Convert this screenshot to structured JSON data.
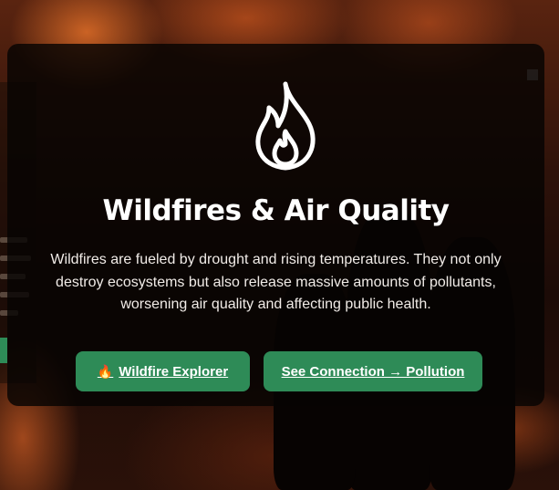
{
  "hero": {
    "title": "Wildfires & Air Quality",
    "description": "Wildfires are fueled by drought and rising temperatures. They not only destroy ecosystems but also release massive amounts of pollutants, worsening air quality and affecting public health."
  },
  "buttons": {
    "explorer_icon": "🔥",
    "explorer_label": "Wildfire Explorer",
    "connection_label": "See Connection → Pollution"
  },
  "icons": {
    "hero_icon": "flame-icon"
  },
  "colors": {
    "button_bg": "#2e8b57",
    "card_bg": "rgba(6,4,3,0.82)",
    "text": "#ffffff"
  }
}
